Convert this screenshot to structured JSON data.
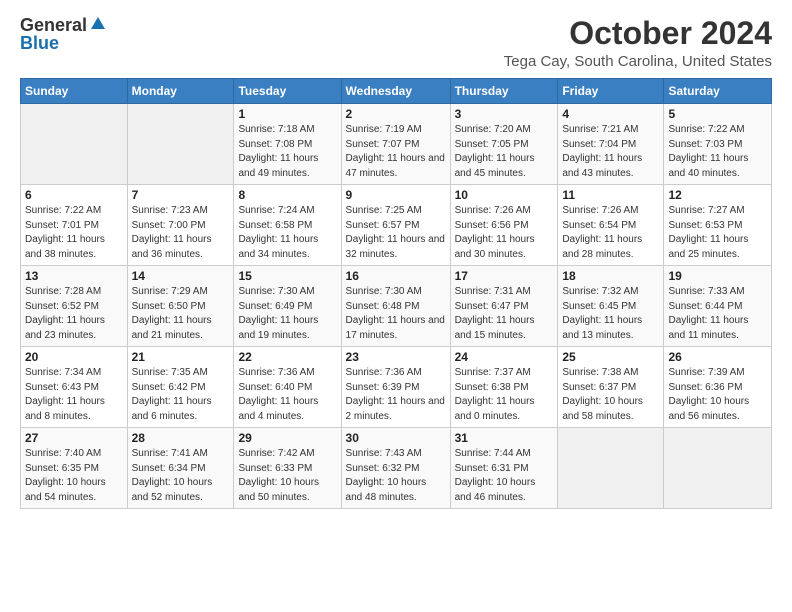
{
  "logo": {
    "general": "General",
    "blue": "Blue"
  },
  "title": "October 2024",
  "subtitle": "Tega Cay, South Carolina, United States",
  "days_of_week": [
    "Sunday",
    "Monday",
    "Tuesday",
    "Wednesday",
    "Thursday",
    "Friday",
    "Saturday"
  ],
  "weeks": [
    [
      {
        "day": "",
        "detail": ""
      },
      {
        "day": "",
        "detail": ""
      },
      {
        "day": "1",
        "detail": "Sunrise: 7:18 AM\nSunset: 7:08 PM\nDaylight: 11 hours and 49 minutes."
      },
      {
        "day": "2",
        "detail": "Sunrise: 7:19 AM\nSunset: 7:07 PM\nDaylight: 11 hours and 47 minutes."
      },
      {
        "day": "3",
        "detail": "Sunrise: 7:20 AM\nSunset: 7:05 PM\nDaylight: 11 hours and 45 minutes."
      },
      {
        "day": "4",
        "detail": "Sunrise: 7:21 AM\nSunset: 7:04 PM\nDaylight: 11 hours and 43 minutes."
      },
      {
        "day": "5",
        "detail": "Sunrise: 7:22 AM\nSunset: 7:03 PM\nDaylight: 11 hours and 40 minutes."
      }
    ],
    [
      {
        "day": "6",
        "detail": "Sunrise: 7:22 AM\nSunset: 7:01 PM\nDaylight: 11 hours and 38 minutes."
      },
      {
        "day": "7",
        "detail": "Sunrise: 7:23 AM\nSunset: 7:00 PM\nDaylight: 11 hours and 36 minutes."
      },
      {
        "day": "8",
        "detail": "Sunrise: 7:24 AM\nSunset: 6:58 PM\nDaylight: 11 hours and 34 minutes."
      },
      {
        "day": "9",
        "detail": "Sunrise: 7:25 AM\nSunset: 6:57 PM\nDaylight: 11 hours and 32 minutes."
      },
      {
        "day": "10",
        "detail": "Sunrise: 7:26 AM\nSunset: 6:56 PM\nDaylight: 11 hours and 30 minutes."
      },
      {
        "day": "11",
        "detail": "Sunrise: 7:26 AM\nSunset: 6:54 PM\nDaylight: 11 hours and 28 minutes."
      },
      {
        "day": "12",
        "detail": "Sunrise: 7:27 AM\nSunset: 6:53 PM\nDaylight: 11 hours and 25 minutes."
      }
    ],
    [
      {
        "day": "13",
        "detail": "Sunrise: 7:28 AM\nSunset: 6:52 PM\nDaylight: 11 hours and 23 minutes."
      },
      {
        "day": "14",
        "detail": "Sunrise: 7:29 AM\nSunset: 6:50 PM\nDaylight: 11 hours and 21 minutes."
      },
      {
        "day": "15",
        "detail": "Sunrise: 7:30 AM\nSunset: 6:49 PM\nDaylight: 11 hours and 19 minutes."
      },
      {
        "day": "16",
        "detail": "Sunrise: 7:30 AM\nSunset: 6:48 PM\nDaylight: 11 hours and 17 minutes."
      },
      {
        "day": "17",
        "detail": "Sunrise: 7:31 AM\nSunset: 6:47 PM\nDaylight: 11 hours and 15 minutes."
      },
      {
        "day": "18",
        "detail": "Sunrise: 7:32 AM\nSunset: 6:45 PM\nDaylight: 11 hours and 13 minutes."
      },
      {
        "day": "19",
        "detail": "Sunrise: 7:33 AM\nSunset: 6:44 PM\nDaylight: 11 hours and 11 minutes."
      }
    ],
    [
      {
        "day": "20",
        "detail": "Sunrise: 7:34 AM\nSunset: 6:43 PM\nDaylight: 11 hours and 8 minutes."
      },
      {
        "day": "21",
        "detail": "Sunrise: 7:35 AM\nSunset: 6:42 PM\nDaylight: 11 hours and 6 minutes."
      },
      {
        "day": "22",
        "detail": "Sunrise: 7:36 AM\nSunset: 6:40 PM\nDaylight: 11 hours and 4 minutes."
      },
      {
        "day": "23",
        "detail": "Sunrise: 7:36 AM\nSunset: 6:39 PM\nDaylight: 11 hours and 2 minutes."
      },
      {
        "day": "24",
        "detail": "Sunrise: 7:37 AM\nSunset: 6:38 PM\nDaylight: 11 hours and 0 minutes."
      },
      {
        "day": "25",
        "detail": "Sunrise: 7:38 AM\nSunset: 6:37 PM\nDaylight: 10 hours and 58 minutes."
      },
      {
        "day": "26",
        "detail": "Sunrise: 7:39 AM\nSunset: 6:36 PM\nDaylight: 10 hours and 56 minutes."
      }
    ],
    [
      {
        "day": "27",
        "detail": "Sunrise: 7:40 AM\nSunset: 6:35 PM\nDaylight: 10 hours and 54 minutes."
      },
      {
        "day": "28",
        "detail": "Sunrise: 7:41 AM\nSunset: 6:34 PM\nDaylight: 10 hours and 52 minutes."
      },
      {
        "day": "29",
        "detail": "Sunrise: 7:42 AM\nSunset: 6:33 PM\nDaylight: 10 hours and 50 minutes."
      },
      {
        "day": "30",
        "detail": "Sunrise: 7:43 AM\nSunset: 6:32 PM\nDaylight: 10 hours and 48 minutes."
      },
      {
        "day": "31",
        "detail": "Sunrise: 7:44 AM\nSunset: 6:31 PM\nDaylight: 10 hours and 46 minutes."
      },
      {
        "day": "",
        "detail": ""
      },
      {
        "day": "",
        "detail": ""
      }
    ]
  ]
}
